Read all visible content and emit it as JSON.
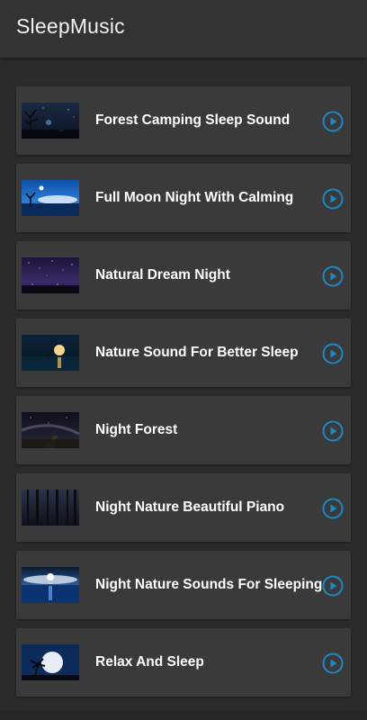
{
  "app": {
    "title": "SleepMusic"
  },
  "colors": {
    "accent": "#1e88c7",
    "appbar": "#333333",
    "card": "#3a3a3a",
    "background": "#2b2b2b"
  },
  "tracks": [
    {
      "title": "Forest Camping Sleep Sound",
      "thumb": "forest-night-tree",
      "icon": "play-circle-icon"
    },
    {
      "title": "Full Moon Night With Calming",
      "thumb": "full-moon-tree",
      "icon": "play-circle-icon"
    },
    {
      "title": "Natural Dream Night",
      "thumb": "starry-purple-night",
      "icon": "play-circle-icon"
    },
    {
      "title": "Nature Sound For Better Sleep",
      "thumb": "moon-over-sea",
      "icon": "play-circle-icon"
    },
    {
      "title": "Night Forest",
      "thumb": "milky-way-road",
      "icon": "play-circle-icon"
    },
    {
      "title": "Night Nature Beautiful Piano",
      "thumb": "dark-forest-trunks",
      "icon": "play-circle-icon"
    },
    {
      "title": "Night Nature Sounds For Sleeping",
      "thumb": "moon-clouds-water",
      "icon": "play-circle-icon"
    },
    {
      "title": "Relax And Sleep",
      "thumb": "moon-palm-silhouette",
      "icon": "play-circle-icon"
    }
  ]
}
